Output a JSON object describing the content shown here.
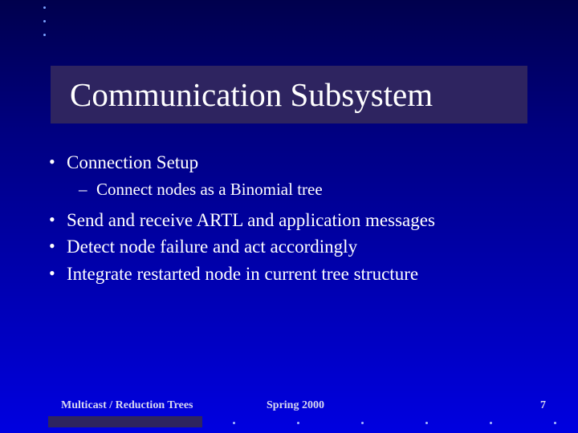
{
  "title": "Communication Subsystem",
  "bullets": {
    "b1": "Connection Setup",
    "b1a": "Connect nodes as a Binomial tree",
    "b2": "Send and receive ARTL and application messages",
    "b3": "Detect node failure and act accordingly",
    "b4": "Integrate restarted node in current tree structure"
  },
  "footer": {
    "left": "Multicast / Reduction Trees",
    "center": "Spring 2000",
    "right": "7"
  }
}
